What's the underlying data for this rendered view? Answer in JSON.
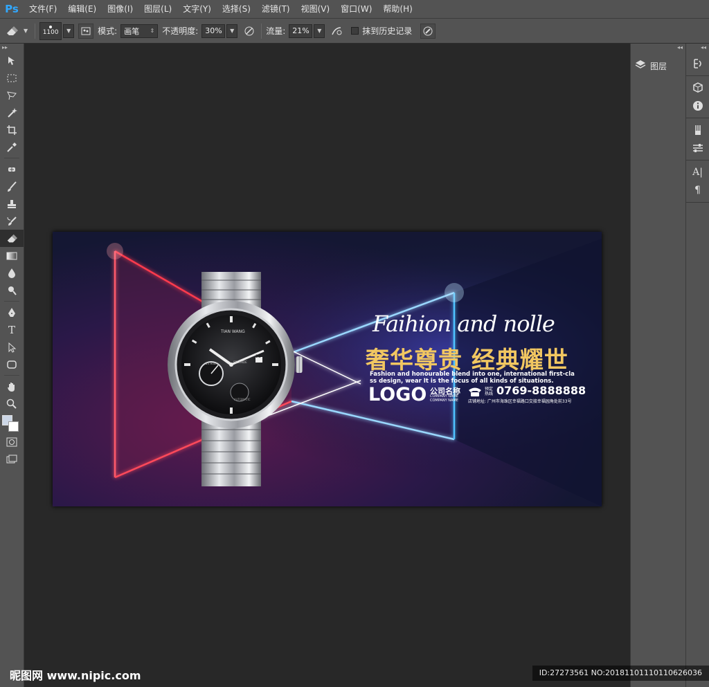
{
  "app": {
    "logo": "Ps"
  },
  "menu": [
    "文件(F)",
    "编辑(E)",
    "图像(I)",
    "图层(L)",
    "文字(Y)",
    "选择(S)",
    "滤镜(T)",
    "视图(V)",
    "窗口(W)",
    "帮助(H)"
  ],
  "options": {
    "brush_size": "1100",
    "mode_label": "模式:",
    "mode_value": "画笔",
    "opacity_label": "不透明度:",
    "opacity_value": "30%",
    "flow_label": "流量:",
    "flow_value": "21%",
    "history_label": "抹到历史记录"
  },
  "panels": {
    "layers_label": "图层"
  },
  "artwork": {
    "script_title": "Faihion and nolle",
    "headline": "奢华尊贵 经典耀世",
    "body_line1": "Fashion and honourable blend into one, international first-cla",
    "body_line2": "ss design, wear It is the focus of all kinds of situations.",
    "logo_text": "LOGO",
    "company_cn": "公司名称",
    "company_en1": "COMPANY NAME",
    "company_en2": "COMPANY NAME",
    "hotline_label1": "预定",
    "hotline_label2": "热线",
    "phone": "0769-8888888",
    "address": "店铺地址: 广州市海珠区幸福路口交接幸福园角处前33号",
    "watch_brand": "TIAN WANG",
    "watch_sub_left": "24 Hours",
    "watch_sub_right": "SECONDE",
    "watch_date": "28",
    "watch_auto": "AUTOMATIC"
  },
  "watermark": {
    "site": "昵图网 www.nipic.com",
    "id_text": "ID:27273561 NO:20181101110110626036"
  },
  "colors": {
    "accent": "#31a8ff",
    "headline_gold": "#f2c761",
    "neon_red": "#ff3b4e",
    "neon_blue": "#4fc3ff"
  }
}
